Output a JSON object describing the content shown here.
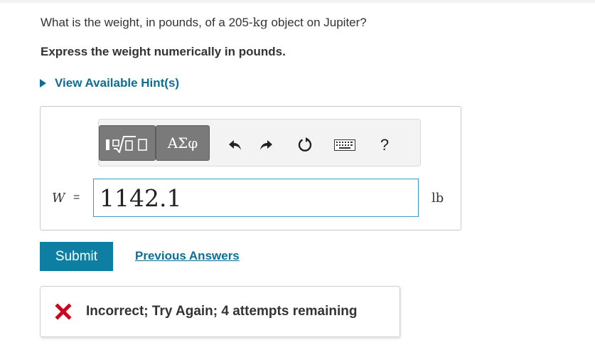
{
  "question": {
    "text_before": "What is the weight, in pounds, of a 205-",
    "unit": "kg",
    "text_after": " object on Jupiter?"
  },
  "instruction": "Express the weight numerically in pounds.",
  "hint": {
    "label": "View Available Hint(s)"
  },
  "toolbar": {
    "greek_label": "ΑΣφ",
    "help_label": "?",
    "icons": [
      "templates-icon",
      "greek-letters-icon",
      "undo-icon",
      "redo-icon",
      "reset-icon",
      "keyboard-icon",
      "help-icon"
    ]
  },
  "answer": {
    "variable": "W",
    "equals": "=",
    "value": "1142.1",
    "unit": "lb"
  },
  "actions": {
    "submit_label": "Submit",
    "previous_answers_label": "Previous Answers"
  },
  "feedback": {
    "message": "Incorrect; Try Again; 4 attempts remaining",
    "status_color": "#d0021b"
  },
  "colors": {
    "link": "#0d6e95",
    "submit_bg": "#0e7fa3",
    "input_border": "#3a9bc9"
  }
}
